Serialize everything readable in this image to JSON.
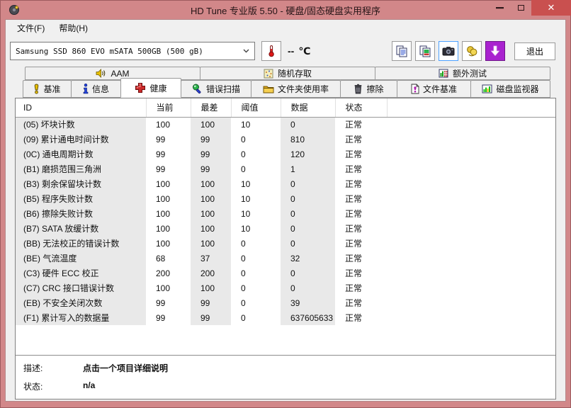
{
  "window": {
    "title": "HD Tune 专业版 5.50 - 硬盘/固态硬盘实用程序",
    "controls": {
      "minimize": "–",
      "maximize": "",
      "close": "✕"
    }
  },
  "menu": {
    "file": "文件(F)",
    "help": "帮助(H)"
  },
  "toolbar": {
    "drive_select": {
      "value": "Samsung SSD 860 EVO mSATA 500GB (500 gB)",
      "chevron": "v"
    },
    "temperature": {
      "value": "--",
      "unit": "℃"
    },
    "buttons": [
      {
        "icon": "copy-text-icon"
      },
      {
        "icon": "copy-image-icon"
      },
      {
        "icon": "camera-icon",
        "active": true
      },
      {
        "icon": "donate-icon"
      },
      {
        "icon": "download-icon"
      }
    ],
    "exit_label": "退出"
  },
  "tabs_top": [
    {
      "label": "AAM",
      "icon": "speaker-icon"
    },
    {
      "label": "随机存取",
      "icon": "random-access-icon"
    },
    {
      "label": "额外测试",
      "icon": "extra-tests-icon"
    }
  ],
  "tabs_main": [
    {
      "label": "基准",
      "icon": "benchmark-icon",
      "active": false
    },
    {
      "label": "信息",
      "icon": "info-icon",
      "active": false
    },
    {
      "label": "健康",
      "icon": "health-icon",
      "active": true
    },
    {
      "label": "错误扫描",
      "icon": "error-scan-icon",
      "active": false
    },
    {
      "label": "文件夹使用率",
      "icon": "folder-icon",
      "active": false
    },
    {
      "label": "擦除",
      "icon": "erase-icon",
      "active": false
    },
    {
      "label": "文件基准",
      "icon": "file-benchmark-icon",
      "active": false
    },
    {
      "label": "磁盘监视器",
      "icon": "disk-monitor-icon",
      "active": false
    }
  ],
  "table": {
    "columns": [
      "ID",
      "当前",
      "最差",
      "阈值",
      "数据",
      "状态"
    ],
    "rows": [
      {
        "id": "(05) 坏块计数",
        "current": "100",
        "worst": "100",
        "threshold": "10",
        "data": "0",
        "status": "正常"
      },
      {
        "id": "(09) 累计通电时间计数",
        "current": "99",
        "worst": "99",
        "threshold": "0",
        "data": "810",
        "status": "正常"
      },
      {
        "id": "(0C) 通电周期计数",
        "current": "99",
        "worst": "99",
        "threshold": "0",
        "data": "120",
        "status": "正常"
      },
      {
        "id": "(B1) 磨损范围三角洲",
        "current": "99",
        "worst": "99",
        "threshold": "0",
        "data": "1",
        "status": "正常"
      },
      {
        "id": "(B3) 剩余保留块计数",
        "current": "100",
        "worst": "100",
        "threshold": "10",
        "data": "0",
        "status": "正常"
      },
      {
        "id": "(B5) 程序失败计数",
        "current": "100",
        "worst": "100",
        "threshold": "10",
        "data": "0",
        "status": "正常"
      },
      {
        "id": "(B6) 擦除失败计数",
        "current": "100",
        "worst": "100",
        "threshold": "10",
        "data": "0",
        "status": "正常"
      },
      {
        "id": "(B7) SATA 放缓计数",
        "current": "100",
        "worst": "100",
        "threshold": "10",
        "data": "0",
        "status": "正常"
      },
      {
        "id": "(BB) 无法校正的错误计数",
        "current": "100",
        "worst": "100",
        "threshold": "0",
        "data": "0",
        "status": "正常"
      },
      {
        "id": "(BE) 气流温度",
        "current": "68",
        "worst": "37",
        "threshold": "0",
        "data": "32",
        "status": "正常"
      },
      {
        "id": "(C3) 硬件 ECC 校正",
        "current": "200",
        "worst": "200",
        "threshold": "0",
        "data": "0",
        "status": "正常"
      },
      {
        "id": "(C7) CRC 接口错误计数",
        "current": "100",
        "worst": "100",
        "threshold": "0",
        "data": "0",
        "status": "正常"
      },
      {
        "id": "(EB) 不安全关闭次数",
        "current": "99",
        "worst": "99",
        "threshold": "0",
        "data": "39",
        "status": "正常"
      },
      {
        "id": "(F1) 累计写入的数据量",
        "current": "99",
        "worst": "99",
        "threshold": "0",
        "data": "637605633",
        "status": "正常"
      }
    ]
  },
  "footer": {
    "desc_label": "描述:",
    "desc_value": "点击一个项目详细说明",
    "status_label": "状态:",
    "status_value": "n/a"
  },
  "colors": {
    "titlebar": "#d28789",
    "close_button": "#c9504f",
    "client_bg": "#f0f0f0",
    "row_shade": "#e9e9e9",
    "download_purple": "#a922cf",
    "health_red": "#cc2a2a",
    "status_ok": "正常"
  }
}
